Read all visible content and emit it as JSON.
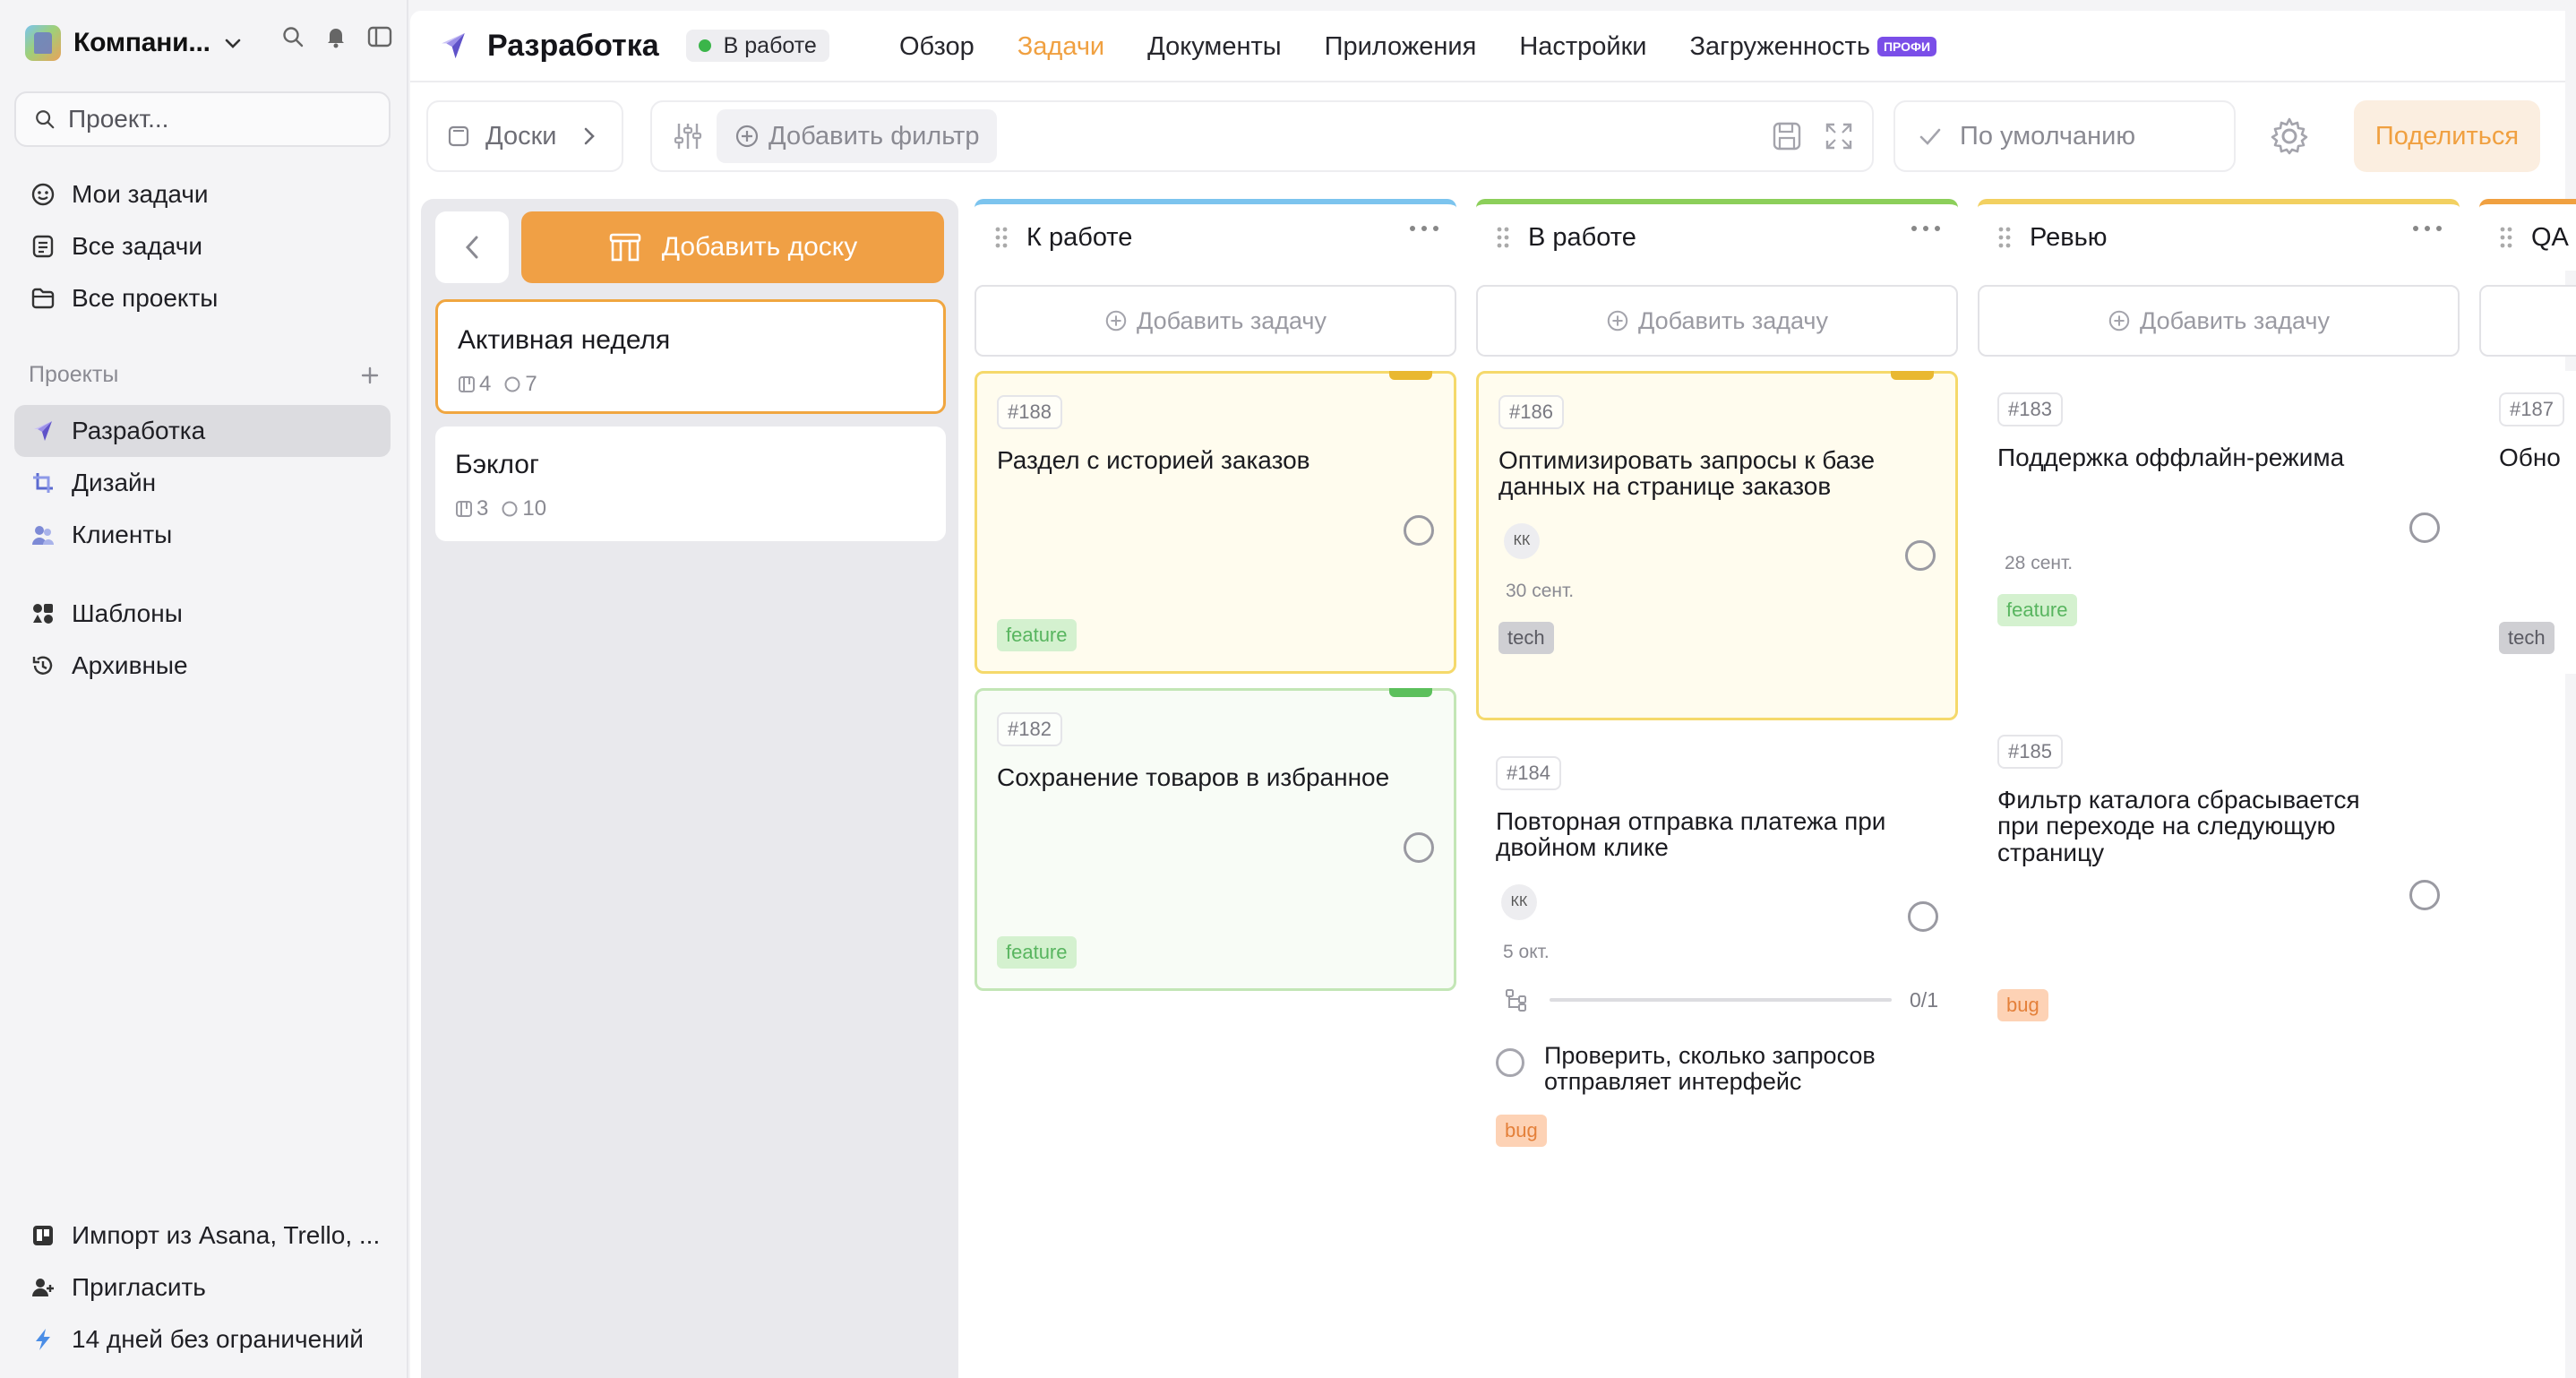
{
  "workspace": {
    "name": "Компани..."
  },
  "search": {
    "placeholder": "Проект..."
  },
  "sidebar": {
    "main_items": [
      {
        "label": "Мои задачи",
        "icon": "my-tasks-icon"
      },
      {
        "label": "Все задачи",
        "icon": "all-tasks-icon"
      },
      {
        "label": "Все проекты",
        "icon": "folder-icon"
      }
    ],
    "projects_label": "Проекты",
    "projects": [
      {
        "label": "Разработка",
        "icon": "rocket-icon",
        "active": true
      },
      {
        "label": "Дизайн",
        "icon": "crop-icon"
      },
      {
        "label": "Клиенты",
        "icon": "users-icon"
      }
    ],
    "extra_items": [
      {
        "label": "Шаблоны",
        "icon": "templates-icon"
      },
      {
        "label": "Архивные",
        "icon": "archive-icon"
      }
    ],
    "bottom_items": [
      {
        "label": "Импорт из Asana, Trello, ...",
        "icon": "trello-icon"
      },
      {
        "label": "Пригласить",
        "icon": "add-user-icon"
      },
      {
        "label": "14 дней без ограничений",
        "icon": "lightning-icon"
      }
    ]
  },
  "header": {
    "project_title": "Разработка",
    "status": "В работе",
    "status_color": "#3bb54a",
    "tabs": [
      {
        "label": "Обзор"
      },
      {
        "label": "Задачи",
        "active": true
      },
      {
        "label": "Документы"
      },
      {
        "label": "Приложения"
      },
      {
        "label": "Настройки"
      },
      {
        "label": "Загруженность",
        "badge": "ПРОФИ"
      }
    ]
  },
  "toolbar": {
    "boards_label": "Доски",
    "add_filter": "Добавить фильтр",
    "sort_label": "По умолчанию",
    "share_label": "Поделиться",
    "accent_color": "#f0a040"
  },
  "boards_panel": {
    "add_board": "Добавить доску",
    "boards": [
      {
        "title": "Активная неделя",
        "columns": "4",
        "tasks": "7",
        "active": true
      },
      {
        "title": "Бэклог",
        "columns": "3",
        "tasks": "10"
      }
    ]
  },
  "columns": [
    {
      "title": "К работе",
      "color": "#7cc4ee",
      "add_task": "Добавить задачу",
      "cards": [
        {
          "id": "#188",
          "title": "Раздел с историей заказов",
          "tag": "feature",
          "flag": "#e9b830",
          "style": "yellow"
        },
        {
          "id": "#182",
          "title": "Сохранение товаров в избранное",
          "tag": "feature",
          "flag": "#5cc05c",
          "style": "green"
        }
      ]
    },
    {
      "title": "В работе",
      "color": "#8ccf5a",
      "add_task": "Добавить задачу",
      "cards": [
        {
          "id": "#186",
          "title": "Оптимизировать запросы к базе данных на странице заказов",
          "avatar": "КК",
          "date": "30 сент.",
          "tag": "tech",
          "flag": "#e9b830",
          "style": "yellow"
        },
        {
          "id": "#184",
          "title": "Повторная отправка платежа при двойном клике",
          "avatar": "КК",
          "date": "5 окт.",
          "subtasks_count": "0/1",
          "subtasks_progress": 0,
          "subtask": "Проверить, сколько запросов отправляет интерфейс",
          "tag": "bug"
        }
      ]
    },
    {
      "title": "Ревью",
      "color": "#f2d060",
      "add_task": "Добавить задачу",
      "cards": [
        {
          "id": "#183",
          "title": "Поддержка оффлайн-режима",
          "date": "28 сент.",
          "tag": "feature"
        },
        {
          "id": "#185",
          "title": "Фильтр каталога сбрасывается при переходе на следующую страницу",
          "tag": "bug"
        }
      ]
    },
    {
      "title": "QA",
      "color": "#f0a040",
      "cards": [
        {
          "id": "#187",
          "title": "Обно",
          "tag": "tech"
        }
      ]
    }
  ]
}
